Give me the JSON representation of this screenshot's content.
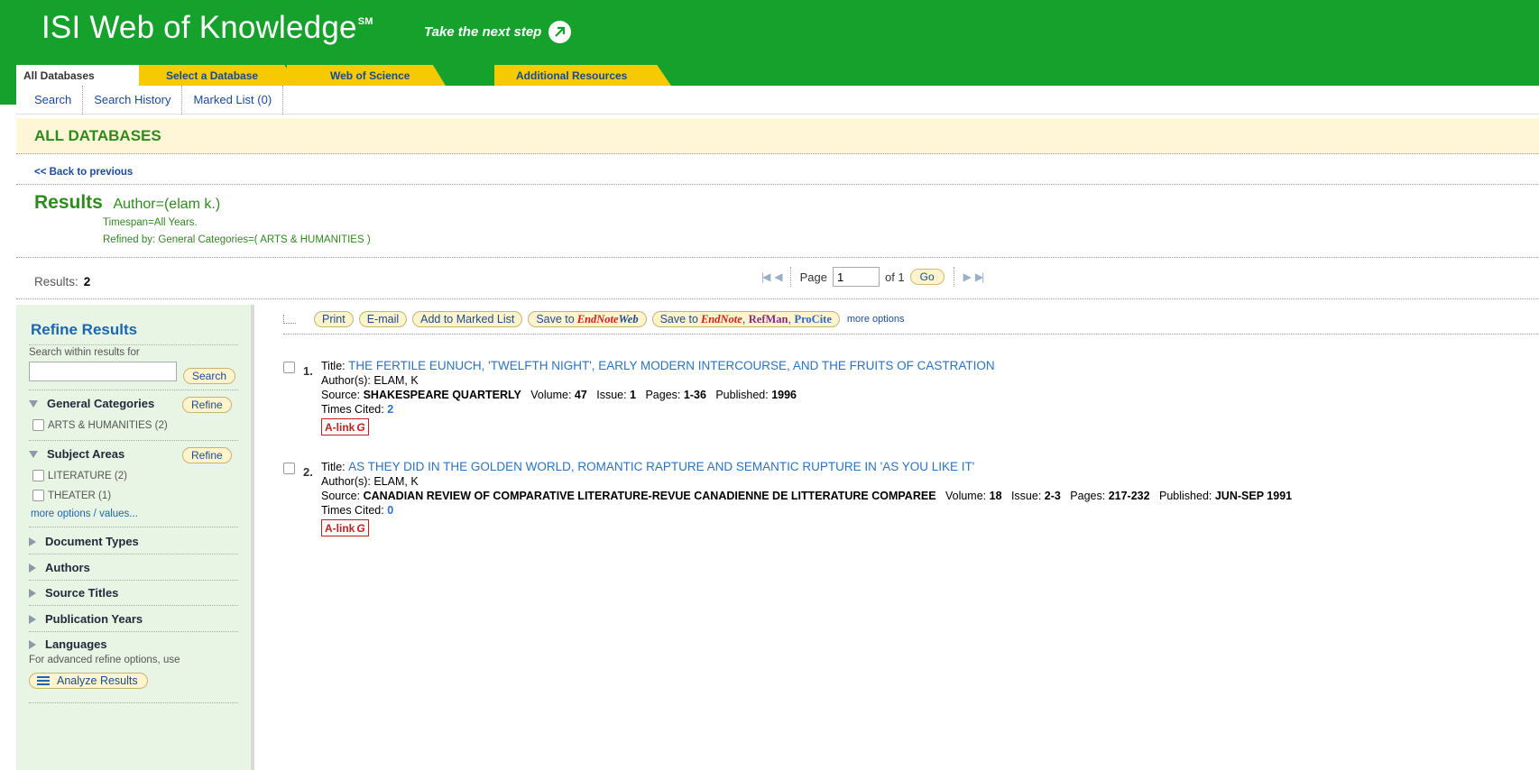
{
  "header": {
    "brand": "ISI Web of Knowledge",
    "brand_sup": "SM",
    "tagline": "Take the next step"
  },
  "tabs": [
    {
      "label": "All Databases"
    },
    {
      "label": "Select a Database"
    },
    {
      "label": "Web of Science"
    },
    {
      "label": "Additional Resources"
    }
  ],
  "subnav": {
    "search": "Search",
    "history": "Search History",
    "marked": "Marked List (0)"
  },
  "section_title": "ALL DATABASES",
  "back_link": "<< Back to previous",
  "results": {
    "title": "Results",
    "query": "Author=(elam k.)",
    "timespan": "Timespan=All Years.",
    "refined": "Refined by: General Categories=( ARTS & HUMANITIES )",
    "count_label": "Results:",
    "count": "2"
  },
  "pager": {
    "page_label": "Page",
    "page_value": "1",
    "of_label": "of 1",
    "go_label": "Go"
  },
  "sidebar": {
    "title": "Refine Results",
    "search_hint": "Search within results for",
    "search_button": "Search",
    "refine_button": "Refine",
    "general_categories": "General Categories",
    "gc_option": "ARTS & HUMANITIES (2)",
    "subject_areas": "Subject Areas",
    "sa_option1": "LITERATURE (2)",
    "sa_option2": "THEATER (1)",
    "more_options": "more options / values...",
    "document_types": "Document Types",
    "authors": "Authors",
    "source_titles": "Source Titles",
    "publication_years": "Publication Years",
    "languages": "Languages",
    "advanced_hint": "For advanced refine options, use",
    "analyze_button": "Analyze Results"
  },
  "toolbar": {
    "print": "Print",
    "email": "E-mail",
    "add_marked": "Add to Marked List",
    "save_to": "Save to",
    "endnote": "EndNote",
    "web": "Web",
    "refman": "RefMan",
    "procite": "ProCite",
    "more_options": "more options"
  },
  "records": [
    {
      "num": "1.",
      "title_label": "Title:",
      "title": "THE FERTILE EUNUCH, 'TWELFTH NIGHT', EARLY MODERN INTERCOURSE, AND THE FRUITS OF CASTRATION",
      "authors": "Author(s): ELAM, K",
      "source_label": "Source:",
      "source": "SHAKESPEARE QUARTERLY",
      "volume_label": "Volume:",
      "volume": "47",
      "issue_label": "Issue:",
      "issue": "1",
      "pages_label": "Pages:",
      "pages": "1-36",
      "published_label": "Published:",
      "published": "1996",
      "cited_label": "Times Cited:",
      "cited": "2",
      "alink": "A-link"
    },
    {
      "num": "2.",
      "title_label": "Title:",
      "title": "AS THEY DID IN THE GOLDEN WORLD, ROMANTIC RAPTURE AND SEMANTIC RUPTURE IN 'AS YOU LIKE IT'",
      "authors": "Author(s): ELAM, K",
      "source_label": "Source:",
      "source": "CANADIAN REVIEW OF COMPARATIVE LITERATURE-REVUE CANADIENNE DE LITTERATURE COMPAREE",
      "volume_label": "Volume:",
      "volume": "18",
      "issue_label": "Issue:",
      "issue": "2-3",
      "pages_label": "Pages:",
      "pages": "217-232",
      "published_label": "Published:",
      "published": "JUN-SEP 1991",
      "cited_label": "Times Cited:",
      "cited": "0",
      "alink": "A-link"
    }
  ],
  "colors": {
    "header_green": "#16a12c",
    "tab_yellow": "#f7c900",
    "title_blue": "#2a73c0",
    "results_green": "#2f8a1e"
  }
}
